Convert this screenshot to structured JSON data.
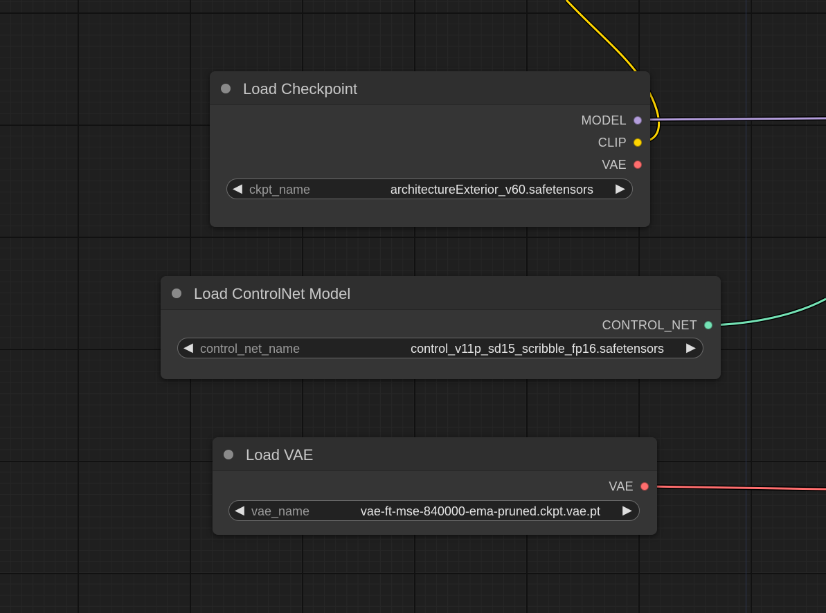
{
  "colors": {
    "model": "#b39ddb",
    "clip": "#ffd500",
    "vae": "#ff6e6e",
    "control_net": "#74e2b5",
    "node_bg": "#353535",
    "canvas_bg": "#1f1f1f"
  },
  "icons": {
    "collapse": "collapse-dot",
    "arrow_left": "◀",
    "arrow_right": "▶"
  },
  "nodes": {
    "checkpoint": {
      "title": "Load Checkpoint",
      "outputs": [
        "MODEL",
        "CLIP",
        "VAE"
      ],
      "widget": {
        "name": "ckpt_name",
        "value": "architectureExterior_v60.safetensors"
      }
    },
    "controlnet": {
      "title": "Load ControlNet Model",
      "outputs": [
        "CONTROL_NET"
      ],
      "widget": {
        "name": "control_net_name",
        "value": "control_v11p_sd15_scribble_fp16.safetensors"
      }
    },
    "vae": {
      "title": "Load VAE",
      "outputs": [
        "VAE"
      ],
      "widget": {
        "name": "vae_name",
        "value": "vae-ft-mse-840000-ema-pruned.ckpt.vae.pt"
      }
    }
  }
}
